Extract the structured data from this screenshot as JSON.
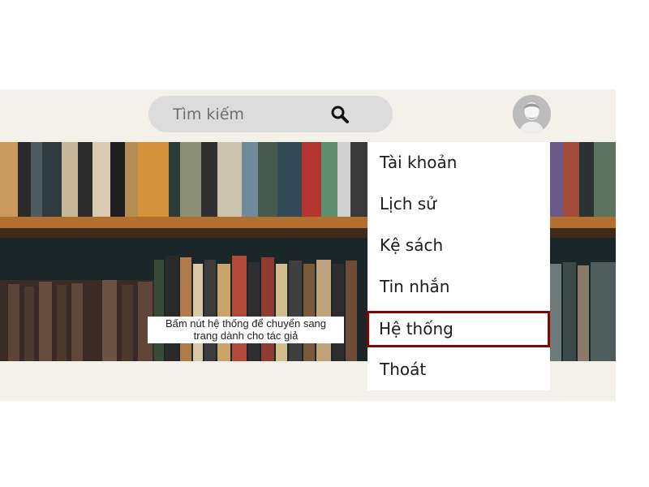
{
  "search": {
    "placeholder": "Tìm kiếm",
    "icon": "search-icon"
  },
  "user": {
    "avatar_icon": "user-avatar-icon"
  },
  "banner": {
    "caption_line1": "Bấm nút hệ thống để chuyển sang",
    "caption_line2": "trang dành cho tác giả"
  },
  "menu": {
    "items": [
      {
        "label": "Tài khoản"
      },
      {
        "label": "Lịch sử"
      },
      {
        "label": "Kệ sách"
      },
      {
        "label": "Tin nhắn"
      },
      {
        "label": "Hệ thống"
      },
      {
        "label": "Thoát"
      }
    ],
    "highlight_color": "#8b0000"
  }
}
